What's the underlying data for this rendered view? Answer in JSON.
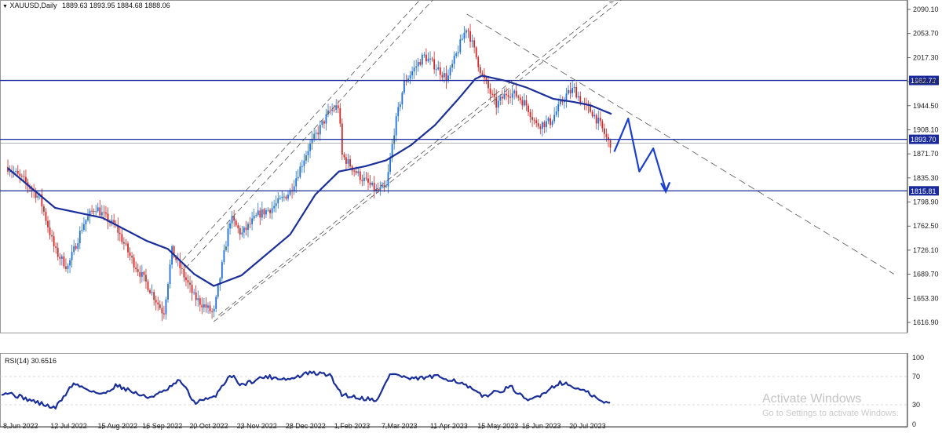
{
  "header": {
    "symbol": "XAUUSD,Daily",
    "ohlc": "1889.63 1893.95 1884.68 1888.06"
  },
  "rsi_header": "RSI(14) 30.6516",
  "watermark": {
    "title": "Activate Windows",
    "subtitle": "Go to Settings to activate Windows."
  },
  "colors": {
    "bull_candle": "#1e6fd6",
    "bear_candle": "#d02828",
    "ma_line": "#1a2f9a",
    "level_line": "#1a2a9a",
    "channel_line": "#555555",
    "rsi_line": "#1a2f9a",
    "forecast_arrow": "#1a3fd0",
    "grid": "#cccccc",
    "background": "#ffffff"
  },
  "chart_data": [
    {
      "type": "candlestick",
      "title": "XAUUSD,Daily",
      "ylim": [
        1600,
        2110
      ],
      "y_ticks": [
        "2090.10",
        "2053.70",
        "2017.30",
        "1980.90",
        "1944.50",
        "1908.10",
        "1871.70",
        "1835.30",
        "1798.90",
        "1762.50",
        "1726.10",
        "1689.70",
        "1653.30",
        "1616.90"
      ],
      "x_ticks": [
        "8 Jun 2022",
        "12 Jul 2022",
        "15 Aug 2022",
        "16 Sep 2022",
        "20 Oct 2022",
        "23 Nov 2022",
        "28 Dec 2022",
        "1 Feb 2023",
        "7 Mar 2023",
        "11 Apr 2023",
        "15 May 2023",
        "16 Jun 2023",
        "20 Jul 2023"
      ],
      "price_path": [
        [
          "8 Jun 2022",
          1852
        ],
        [
          "20 Jun 2022",
          1830
        ],
        [
          "1 Jul 2022",
          1805
        ],
        [
          "12 Jul 2022",
          1725
        ],
        [
          "21 Jul 2022",
          1700
        ],
        [
          "1 Aug 2022",
          1765
        ],
        [
          "10 Aug 2022",
          1792
        ],
        [
          "15 Aug 2022",
          1780
        ],
        [
          "25 Aug 2022",
          1760
        ],
        [
          "5 Sep 2022",
          1712
        ],
        [
          "16 Sep 2022",
          1675
        ],
        [
          "28 Sep 2022",
          1630
        ],
        [
          "4 Oct 2022",
          1725
        ],
        [
          "20 Oct 2022",
          1655
        ],
        [
          "3 Nov 2022",
          1630
        ],
        [
          "15 Nov 2022",
          1775
        ],
        [
          "23 Nov 2022",
          1750
        ],
        [
          "5 Dec 2022",
          1780
        ],
        [
          "15 Dec 2022",
          1790
        ],
        [
          "28 Dec 2022",
          1815
        ],
        [
          "10 Jan 2023",
          1880
        ],
        [
          "25 Jan 2023",
          1935
        ],
        [
          "1 Feb 2023",
          1945
        ],
        [
          "3 Feb 2023",
          1870
        ],
        [
          "15 Feb 2023",
          1840
        ],
        [
          "28 Feb 2023",
          1815
        ],
        [
          "7 Mar 2023",
          1820
        ],
        [
          "13 Mar 2023",
          1910
        ],
        [
          "20 Mar 2023",
          1980
        ],
        [
          "3 Apr 2023",
          2020
        ],
        [
          "11 Apr 2023",
          2005
        ],
        [
          "20 Apr 2023",
          1985
        ],
        [
          "4 May 2023",
          2065
        ],
        [
          "9 May 2023",
          2030
        ],
        [
          "15 May 2023",
          1990
        ],
        [
          "25 May 2023",
          1945
        ],
        [
          "2 Jun 2023",
          1965
        ],
        [
          "9 Jun 2023",
          1960
        ],
        [
          "16 Jun 2023",
          1945
        ],
        [
          "23 Jun 2023",
          1915
        ],
        [
          "3 Jul 2023",
          1920
        ],
        [
          "14 Jul 2023",
          1960
        ],
        [
          "20 Jul 2023",
          1970
        ],
        [
          "27 Jul 2023",
          1945
        ],
        [
          "2 Aug 2023",
          1935
        ],
        [
          "8 Aug 2023",
          1915
        ],
        [
          "14 Aug 2023",
          1888
        ]
      ],
      "moving_average": [
        [
          "8 Jun 2022",
          1850
        ],
        [
          "12 Jul 2022",
          1790
        ],
        [
          "15 Aug 2022",
          1775
        ],
        [
          "16 Sep 2022",
          1740
        ],
        [
          "1 Oct 2022",
          1728
        ],
        [
          "20 Oct 2022",
          1690
        ],
        [
          "3 Nov 2022",
          1672
        ],
        [
          "23 Nov 2022",
          1688
        ],
        [
          "28 Dec 2022",
          1750
        ],
        [
          "15 Jan 2023",
          1810
        ],
        [
          "1 Feb 2023",
          1845
        ],
        [
          "20 Feb 2023",
          1853
        ],
        [
          "7 Mar 2023",
          1862
        ],
        [
          "25 Mar 2023",
          1885
        ],
        [
          "11 Apr 2023",
          1915
        ],
        [
          "28 Apr 2023",
          1955
        ],
        [
          "10 May 2023",
          1985
        ],
        [
          "15 May 2023",
          1990
        ],
        [
          "1 Jun 2023",
          1982
        ],
        [
          "16 Jun 2023",
          1972
        ],
        [
          "5 Jul 2023",
          1955
        ],
        [
          "20 Jul 2023",
          1950
        ],
        [
          "1 Aug 2023",
          1945
        ],
        [
          "16 Aug 2023",
          1932
        ]
      ],
      "level_markers": [
        "1982.72",
        "1893.70",
        "1815.81"
      ],
      "annotations": {
        "channel": {
          "lower": [
            [
              "3 Nov 2022",
              1618
            ],
            [
              "16 Aug 2023",
              2093
            ]
          ],
          "upper_offset": 95
        },
        "descending_trendline": [
          [
            "4 May 2023",
            2083
          ],
          [
            "6 Mar 2024",
            1690
          ]
        ],
        "forecast_path": [
          [
            "18 Aug 2023",
            1875
          ],
          [
            "28 Aug 2023",
            1925
          ],
          [
            "5 Sep 2023",
            1845
          ],
          [
            "15 Sep 2023",
            1880
          ],
          [
            "24 Sep 2023",
            1817
          ]
        ]
      }
    },
    {
      "type": "line",
      "title": "RSI(14) 30.6516",
      "ylim": [
        0,
        100
      ],
      "y_ticks": [
        "100",
        "70",
        "30",
        "0"
      ],
      "levels": [
        70,
        30
      ],
      "x": [
        "8 Jun 2022",
        "12 Jul 2022",
        "25 Jul 2022",
        "15 Aug 2022",
        "25 Aug 2022",
        "16 Sep 2022",
        "28 Sep 2022",
        "10 Oct 2022",
        "20 Oct 2022",
        "3 Nov 2022",
        "15 Nov 2022",
        "23 Nov 2022",
        "10 Dec 2022",
        "28 Dec 2022",
        "10 Jan 2023",
        "25 Jan 2023",
        "3 Feb 2023",
        "15 Feb 2023",
        "1 Mar 2023",
        "10 Mar 2023",
        "25 Mar 2023",
        "11 Apr 2023",
        "25 Apr 2023",
        "5 May 2023",
        "15 May 2023",
        "25 May 2023",
        "5 Jun 2023",
        "16 Jun 2023",
        "25 Jun 2023",
        "10 Jul 2023",
        "20 Jul 2023",
        "1 Aug 2023",
        "8 Aug 2023",
        "16 Aug 2023"
      ],
      "values": [
        47,
        25,
        60,
        44,
        58,
        40,
        48,
        65,
        33,
        40,
        73,
        58,
        70,
        66,
        75,
        73,
        45,
        40,
        37,
        75,
        66,
        70,
        65,
        55,
        42,
        48,
        55,
        35,
        43,
        62,
        55,
        45,
        35,
        31
      ]
    }
  ]
}
